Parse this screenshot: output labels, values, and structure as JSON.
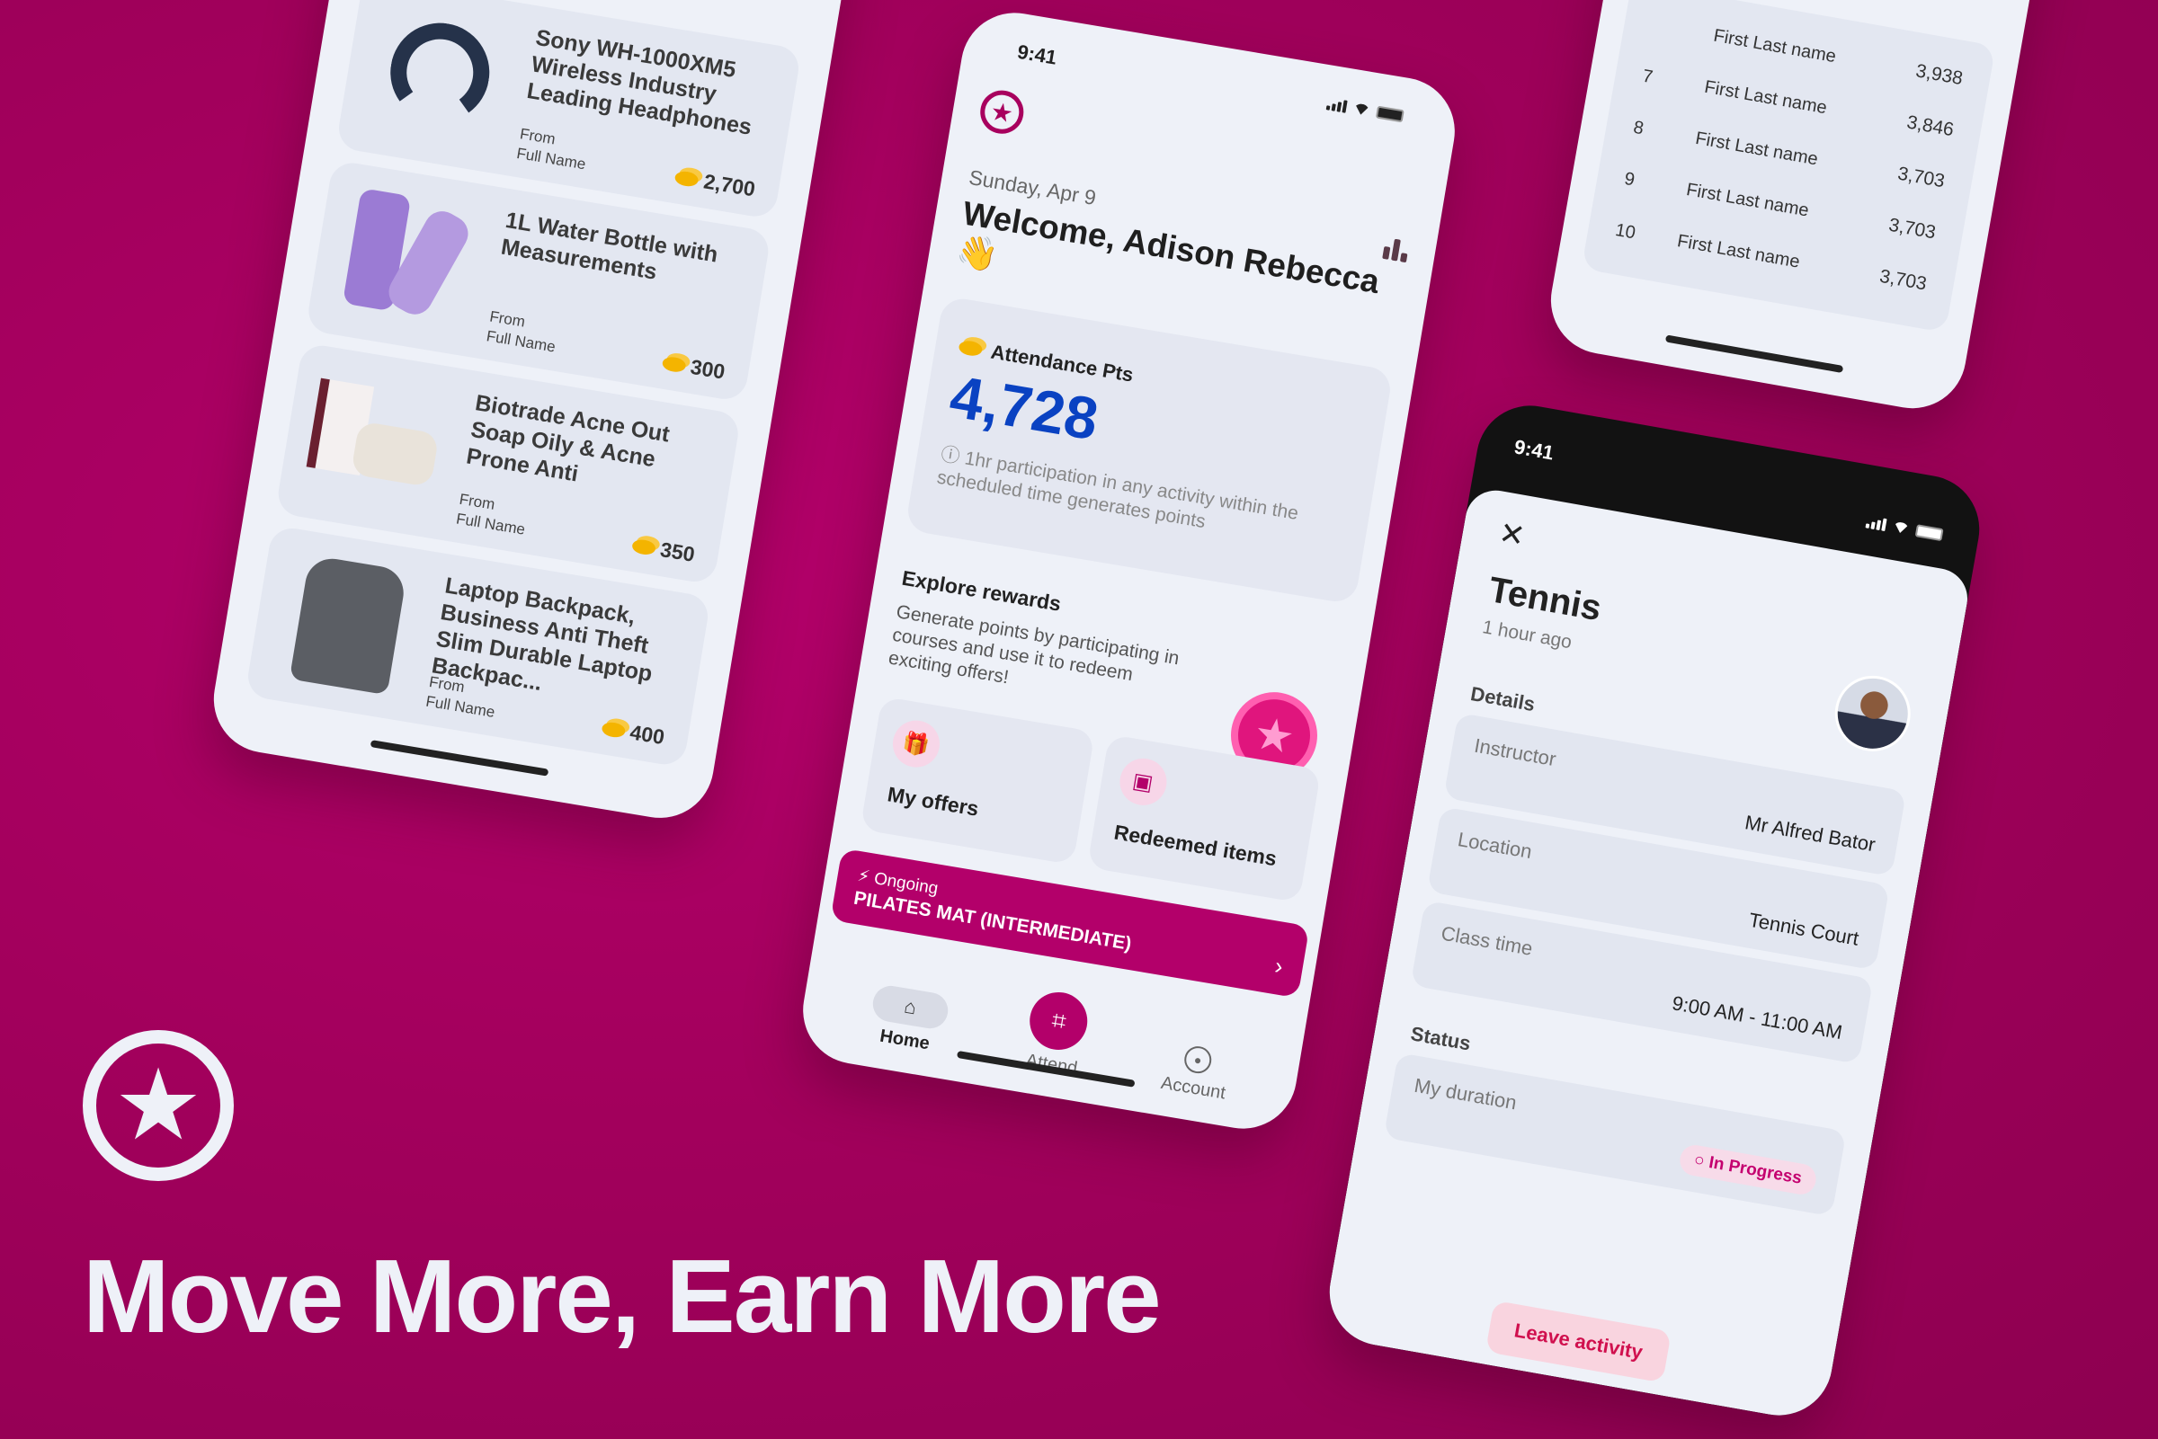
{
  "brand": {
    "accent": "#b3006a",
    "background": "#a2005c",
    "points_color": "#0a42c2",
    "logo_icon": "star-circle-icon"
  },
  "hero": {
    "headline": "Move More, Earn More"
  },
  "products": [
    {
      "title": "Sony WH-1000XM5 Wireless Industry Leading Headphones",
      "from": "From",
      "name": "Full Name",
      "points": "2,700",
      "icon": "headphones"
    },
    {
      "title": "1L Water Bottle with Measurements",
      "from": "From",
      "name": "Full Name",
      "points": "300",
      "icon": "water-bottle"
    },
    {
      "title": "Biotrade Acne Out Soap Oily & Acne Prone Anti",
      "from": "From",
      "name": "Full Name",
      "points": "350",
      "icon": "soap"
    },
    {
      "title": "Laptop Backpack, Business Anti Theft Slim Durable Laptop Backpac...",
      "from": "From",
      "name": "Full Name",
      "points": "400",
      "icon": "backpack"
    }
  ],
  "home": {
    "time": "9:41",
    "date": "Sunday, Apr 9",
    "welcome": "Welcome, Adison Rebecca 👋",
    "points_label": "Attendance Pts",
    "points": "4,728",
    "points_info": "1hr participation in any activity within the scheduled time generates points",
    "explore_title": "Explore rewards",
    "explore_desc": "Generate points by participating in courses and use it to redeem exciting offers!",
    "tiles": [
      {
        "label": "My offers",
        "icon": "gift-icon"
      },
      {
        "label": "Redeemed items",
        "icon": "redeemed-icon"
      }
    ],
    "ongoing_label": "Ongoing",
    "ongoing_class": "PILATES MAT (INTERMEDIATE)",
    "tabs": [
      {
        "label": "Home",
        "icon": "home-icon",
        "active": true
      },
      {
        "label": "Attend",
        "icon": "qr-scan-icon"
      },
      {
        "label": "Account",
        "icon": "account-icon"
      }
    ]
  },
  "leaderboard": [
    {
      "rank": "",
      "name": "First Last name",
      "score": "3,938"
    },
    {
      "rank": "7",
      "name": "First Last name",
      "score": "3,846"
    },
    {
      "rank": "8",
      "name": "First Last name",
      "score": "3,703"
    },
    {
      "rank": "9",
      "name": "First Last name",
      "score": "3,703"
    },
    {
      "rank": "10",
      "name": "First Last name",
      "score": "3,703"
    }
  ],
  "activity": {
    "time": "9:41",
    "title": "Tennis",
    "ago": "1 hour ago",
    "details_label": "Details",
    "rows": [
      {
        "label": "Instructor",
        "value": "Mr Alfred Bator"
      },
      {
        "label": "Location",
        "value": "Tennis Court"
      },
      {
        "label": "Class time",
        "value": "9:00 AM - 11:00 AM"
      }
    ],
    "status_label": "Status",
    "duration_label": "My duration",
    "status": "In Progress",
    "leave": "Leave activity"
  }
}
